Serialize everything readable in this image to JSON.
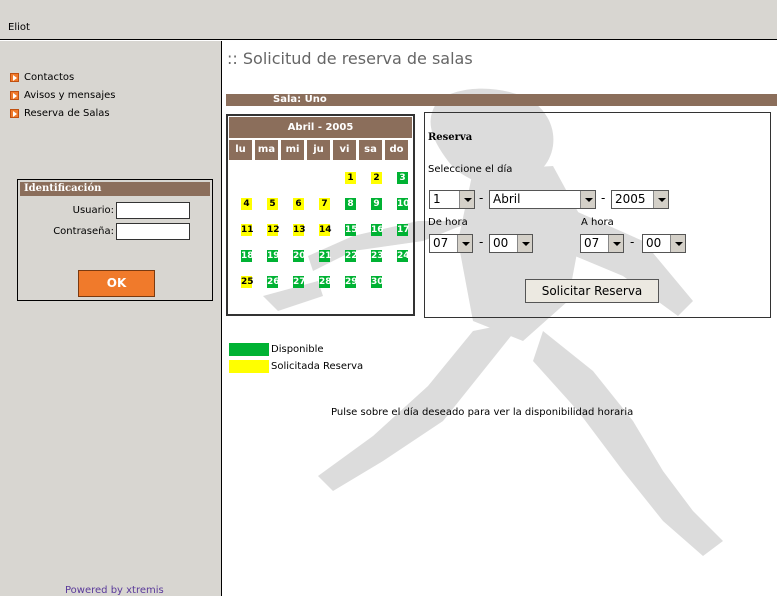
{
  "topbar": {
    "brand": "Eliot"
  },
  "sidebar": {
    "items": [
      {
        "label": "Contactos"
      },
      {
        "label": "Avisos y mensajes"
      },
      {
        "label": "Reserva de Salas"
      }
    ],
    "login": {
      "title": "Identificación",
      "user_label": "Usuario:",
      "user_value": "",
      "pass_label": "Contraseña:",
      "pass_value": "",
      "ok_label": "OK"
    },
    "powered": "Powered by xtremis"
  },
  "main": {
    "title": ":: Solicitud de reserva de salas",
    "sala_label": "Sala:",
    "sala_value": "Uno",
    "calendar": {
      "month": "Abril - 2005",
      "weekdays": [
        "lu",
        "ma",
        "mi",
        "ju",
        "vi",
        "sa",
        "do"
      ],
      "rows": [
        [
          null,
          null,
          null,
          null,
          {
            "d": "1",
            "s": "y"
          },
          {
            "d": "2",
            "s": "y"
          },
          {
            "d": "3",
            "s": "g"
          }
        ],
        [
          {
            "d": "4",
            "s": "y"
          },
          {
            "d": "5",
            "s": "y"
          },
          {
            "d": "6",
            "s": "y"
          },
          {
            "d": "7",
            "s": "y"
          },
          {
            "d": "8",
            "s": "g"
          },
          {
            "d": "9",
            "s": "g"
          },
          {
            "d": "10",
            "s": "g"
          }
        ],
        [
          {
            "d": "11",
            "s": "y"
          },
          {
            "d": "12",
            "s": "y"
          },
          {
            "d": "13",
            "s": "y"
          },
          {
            "d": "14",
            "s": "y"
          },
          {
            "d": "15",
            "s": "g"
          },
          {
            "d": "16",
            "s": "g"
          },
          {
            "d": "17",
            "s": "g"
          }
        ],
        [
          {
            "d": "18",
            "s": "g"
          },
          {
            "d": "19",
            "s": "g"
          },
          {
            "d": "20",
            "s": "g"
          },
          {
            "d": "21",
            "s": "g"
          },
          {
            "d": "22",
            "s": "g"
          },
          {
            "d": "23",
            "s": "g"
          },
          {
            "d": "24",
            "s": "g"
          }
        ],
        [
          {
            "d": "25",
            "s": "y"
          },
          {
            "d": "26",
            "s": "g"
          },
          {
            "d": "27",
            "s": "g"
          },
          {
            "d": "28",
            "s": "g"
          },
          {
            "d": "29",
            "s": "g"
          },
          {
            "d": "30",
            "s": "g"
          },
          {
            "d": "",
            "s": "w"
          }
        ],
        [
          null,
          null,
          null,
          null,
          null,
          null,
          {
            "d": "",
            "s": "w"
          }
        ]
      ]
    },
    "reserva": {
      "title": "Reserva",
      "select_day_label": "Seleccione el día",
      "day_value": "1",
      "month_value": "Abril",
      "year_value": "2005",
      "from_label": "De hora",
      "from_hour": "07",
      "from_min": "00",
      "to_label": "A hora",
      "to_hour": "07",
      "to_min": "00",
      "submit_label": "Solicitar Reserva",
      "sep": "-"
    },
    "legend": [
      {
        "label": "Disponible",
        "color": "#00b233"
      },
      {
        "label": "Solicitada Reserva",
        "color": "#ffff00"
      }
    ],
    "hint": "Pulse sobre el día deseado para ver la disponibilidad horaria"
  },
  "colors": {
    "accent_brown": "#8b6e5b",
    "accent_orange": "#f07a2b",
    "sidebar_bg": "#d8d6d1"
  }
}
